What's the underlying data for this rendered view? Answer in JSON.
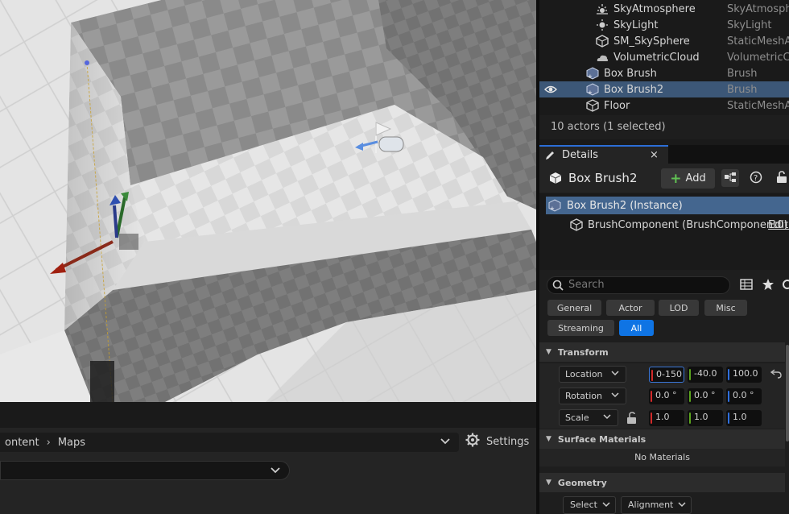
{
  "outliner": {
    "rows": [
      {
        "name": "SkyAtmosphere",
        "type": "SkyAtmosph",
        "icon": "sun-icon"
      },
      {
        "name": "SkyLight",
        "type": "SkyLight",
        "icon": "skylight-icon"
      },
      {
        "name": "SM_SkySphere",
        "type": "StaticMeshA",
        "icon": "static-mesh-icon"
      },
      {
        "name": "VolumetricCloud",
        "type": "VolumetricCl",
        "icon": "cloud-icon"
      },
      {
        "name": "Box Brush",
        "type": "Brush",
        "icon": "brush-icon"
      },
      {
        "name": "Box Brush2",
        "type": "Brush",
        "icon": "brush-icon",
        "selected": true
      },
      {
        "name": "Floor",
        "type": "StaticMeshA",
        "icon": "static-mesh-icon"
      }
    ],
    "count_text": "10 actors (1 selected)"
  },
  "details": {
    "tab_title": "Details",
    "close": "×",
    "actor_name": "Box Brush2",
    "add_label": "Add",
    "components": {
      "instance": "Box Brush2 (Instance)",
      "brush": "BrushComponent (BrushComponent0)",
      "edit_link": "Edit i"
    },
    "search_placeholder": "Search",
    "filters": [
      "General",
      "Actor",
      "LOD",
      "Misc",
      "Streaming",
      "All"
    ],
    "active_filter": "All",
    "transform": {
      "header": "Transform",
      "location": {
        "label": "Location",
        "x": "0-150",
        "y": "-40.0",
        "z": "100.0"
      },
      "rotation": {
        "label": "Rotation",
        "x": "0.0 °",
        "y": "0.0 °",
        "z": "0.0 °"
      },
      "scale": {
        "label": "Scale",
        "x": "1.0",
        "y": "1.0",
        "z": "1.0"
      }
    },
    "surface_materials": {
      "header": "Surface Materials",
      "empty_text": "No Materials"
    },
    "geometry": {
      "header": "Geometry",
      "select_label": "Select",
      "alignment_label": "Alignment"
    }
  },
  "content_browser": {
    "path": [
      "ontent",
      "Maps"
    ],
    "settings_label": "Settings"
  },
  "colors": {
    "selection": "#3c5777",
    "accent": "#0f74e4",
    "x_axis": "#d22a2a",
    "y_axis": "#5aa51e",
    "z_axis": "#2f6fdd"
  }
}
